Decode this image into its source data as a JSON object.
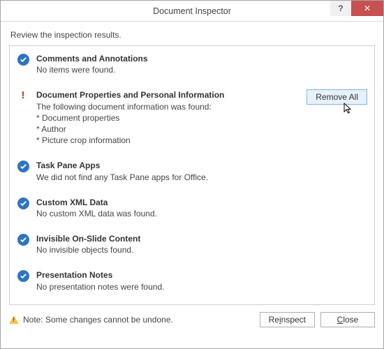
{
  "window": {
    "title": "Document Inspector",
    "help_label": "?",
    "close_label": "✕"
  },
  "instruction": "Review the inspection results.",
  "sections": {
    "comments": {
      "title": "Comments and Annotations",
      "body": "No items were found."
    },
    "docprops": {
      "title": "Document Properties and Personal Information",
      "body_line": "The following document information was found:",
      "item1": "* Document properties",
      "item2": "* Author",
      "item3": "* Picture crop information",
      "remove_label": "Remove All"
    },
    "taskpane": {
      "title": "Task Pane Apps",
      "body": "We did not find any Task Pane apps for Office."
    },
    "xml": {
      "title": "Custom XML Data",
      "body": "No custom XML data was found."
    },
    "invisible": {
      "title": "Invisible On-Slide Content",
      "body": "No invisible objects found."
    },
    "notes": {
      "title": "Presentation Notes",
      "body": "No presentation notes were found."
    }
  },
  "footer": {
    "note": "Note: Some changes cannot be undone.",
    "reinspect_pre": "Re",
    "reinspect_u": "i",
    "reinspect_post": "nspect",
    "close_u": "C",
    "close_post": "lose"
  }
}
